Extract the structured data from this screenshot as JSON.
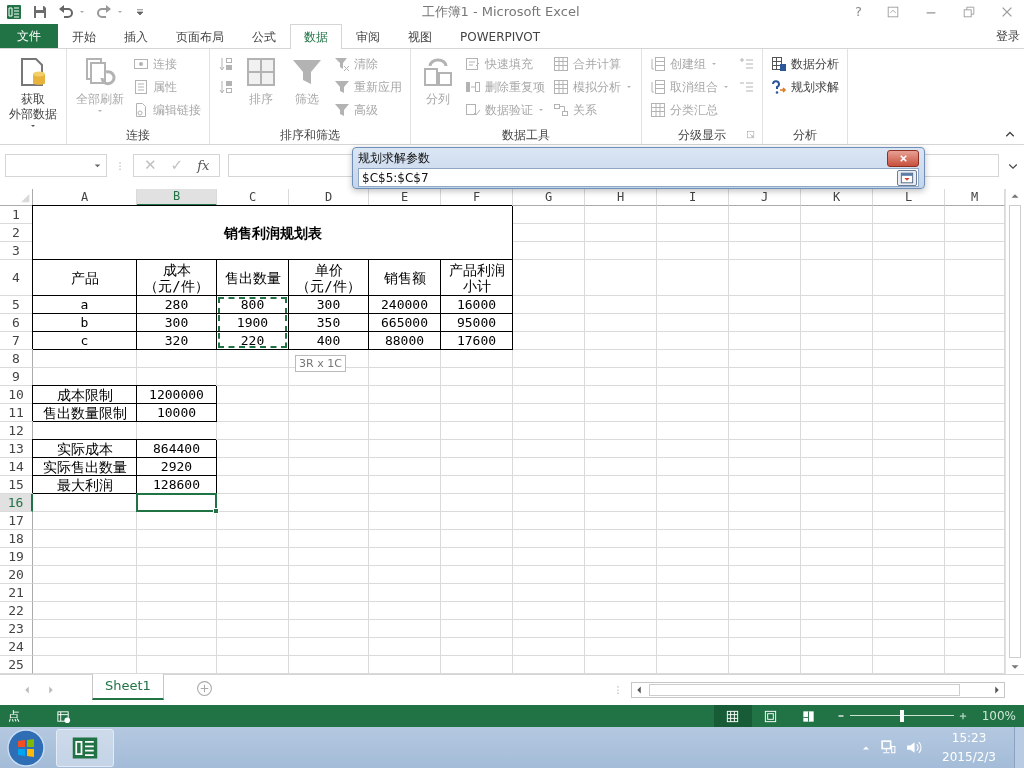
{
  "title_bar": {
    "title": "工作簿1 - Microsoft Excel",
    "help": "?"
  },
  "ribbon_tabs": [
    {
      "label": "文件",
      "kind": "file",
      "selected": false
    },
    {
      "label": "开始",
      "kind": "tab",
      "selected": false
    },
    {
      "label": "插入",
      "kind": "tab",
      "selected": false
    },
    {
      "label": "页面布局",
      "kind": "tab",
      "selected": false
    },
    {
      "label": "公式",
      "kind": "tab",
      "selected": false
    },
    {
      "label": "数据",
      "kind": "tab",
      "selected": true
    },
    {
      "label": "审阅",
      "kind": "tab",
      "selected": false
    },
    {
      "label": "视图",
      "kind": "tab",
      "selected": false
    },
    {
      "label": "POWERPIVOT",
      "kind": "tab",
      "selected": false
    }
  ],
  "account": "登录",
  "ribbon_groups": [
    {
      "columns": [
        [
          {
            "label": [
              "获取",
              "外部数据"
            ],
            "kind": "large",
            "disabled": false,
            "dropdown": true
          }
        ]
      ]
    },
    {
      "label": "连接",
      "columns": [
        [
          {
            "label": "全部刷新",
            "kind": "large",
            "disabled": true,
            "dropdown": true
          }
        ],
        [
          {
            "label": "连接",
            "kind": "small",
            "disabled": true
          },
          {
            "label": "属性",
            "kind": "small",
            "disabled": true
          },
          {
            "label": "编辑链接",
            "kind": "small",
            "disabled": true
          }
        ]
      ]
    },
    {
      "label": "排序和筛选",
      "columns": [
        [
          {
            "kind": "icon",
            "disabled": true
          },
          {
            "kind": "icon",
            "disabled": true
          }
        ],
        [
          {
            "label": "排序",
            "kind": "large",
            "disabled": true
          }
        ],
        [
          {
            "label": "筛选",
            "kind": "large",
            "disabled": true
          }
        ],
        [
          {
            "label": "清除",
            "kind": "small",
            "disabled": true
          },
          {
            "label": "重新应用",
            "kind": "small",
            "disabled": true
          },
          {
            "label": "高级",
            "kind": "small",
            "disabled": true
          }
        ]
      ]
    },
    {
      "label": "数据工具",
      "columns": [
        [
          {
            "label": "分列",
            "kind": "large",
            "disabled": true
          }
        ],
        [
          {
            "label": "快速填充",
            "kind": "small",
            "disabled": true
          },
          {
            "label": "删除重复项",
            "kind": "small",
            "disabled": true
          },
          {
            "label": "数据验证",
            "kind": "small",
            "disabled": true,
            "dropdown": true
          }
        ],
        [
          {
            "label": "合并计算",
            "kind": "small",
            "disabled": true
          },
          {
            "label": "模拟分析",
            "kind": "small",
            "disabled": true,
            "dropdown": true
          },
          {
            "label": "关系",
            "kind": "small",
            "disabled": true
          }
        ]
      ]
    },
    {
      "label": "分级显示",
      "launcher": true,
      "columns": [
        [
          {
            "label": "创建组",
            "kind": "small",
            "disabled": true,
            "dropdown": true
          },
          {
            "label": "取消组合",
            "kind": "small",
            "disabled": true,
            "dropdown": true
          },
          {
            "label": "分类汇总",
            "kind": "small",
            "disabled": true
          }
        ],
        [
          {
            "kind": "icon",
            "disabled": true
          },
          {
            "kind": "icon",
            "disabled": true
          }
        ]
      ]
    },
    {
      "label": "分析",
      "columns": [
        [
          {
            "label": "数据分析",
            "kind": "small",
            "disabled": false
          },
          {
            "label": "规划求解",
            "kind": "small",
            "disabled": false
          }
        ]
      ]
    }
  ],
  "formula_bar": {
    "buttons": [
      {
        "label": "✕",
        "disabled": true
      },
      {
        "label": "✓",
        "disabled": true
      },
      {
        "label": "fx",
        "disabled": false
      }
    ]
  },
  "solver_dialog": {
    "title": "规划求解参数",
    "value": "$C$5:$C$7"
  },
  "sheet": {
    "columns": [
      {
        "label": "A",
        "selected": false
      },
      {
        "label": "B",
        "selected": true
      },
      {
        "label": "C",
        "selected": false
      },
      {
        "label": "D",
        "selected": false
      },
      {
        "label": "E",
        "selected": false
      },
      {
        "label": "F",
        "selected": false
      },
      {
        "label": "G",
        "selected": false
      },
      {
        "label": "H",
        "selected": false
      },
      {
        "label": "I",
        "selected": false
      },
      {
        "label": "J",
        "selected": false
      },
      {
        "label": "K",
        "selected": false
      },
      {
        "label": "L",
        "selected": false
      },
      {
        "label": "M",
        "selected": false
      }
    ],
    "rows": [
      {
        "label": "1",
        "selected": false
      },
      {
        "label": "2",
        "selected": false
      },
      {
        "label": "3",
        "selected": false
      },
      {
        "label": "4",
        "selected": false
      },
      {
        "label": "5",
        "selected": false
      },
      {
        "label": "6",
        "selected": false
      },
      {
        "label": "7",
        "selected": false
      },
      {
        "label": "8",
        "selected": false
      },
      {
        "label": "9",
        "selected": false
      },
      {
        "label": "10",
        "selected": false
      },
      {
        "label": "11",
        "selected": false
      },
      {
        "label": "12",
        "selected": false
      },
      {
        "label": "13",
        "selected": false
      },
      {
        "label": "14",
        "selected": false
      },
      {
        "label": "15",
        "selected": false
      },
      {
        "label": "16",
        "selected": true
      },
      {
        "label": "17",
        "selected": false
      },
      {
        "label": "18",
        "selected": false
      },
      {
        "label": "19",
        "selected": false
      },
      {
        "label": "20",
        "selected": false
      },
      {
        "label": "21",
        "selected": false
      },
      {
        "label": "22",
        "selected": false
      },
      {
        "label": "23",
        "selected": false
      },
      {
        "label": "24",
        "selected": false
      },
      {
        "label": "25",
        "selected": false
      }
    ],
    "title": "销售利润规划表",
    "table": {
      "headers": [
        "产品",
        [
          "成本",
          "（元/件）"
        ],
        "售出数量",
        [
          "单价",
          "（元/件）"
        ],
        "销售额",
        [
          "产品利润",
          "小计"
        ]
      ],
      "rows": [
        [
          "a",
          "280",
          "800",
          "300",
          "240000",
          "16000"
        ],
        [
          "b",
          "300",
          "1900",
          "350",
          "665000",
          "95000"
        ],
        [
          "c",
          "320",
          "220",
          "400",
          "88000",
          "17600"
        ]
      ]
    },
    "limits": [
      {
        "label": "成本限制",
        "value": "1200000"
      },
      {
        "label": "售出数量限制",
        "value": "10000"
      }
    ],
    "results": [
      {
        "label": "实际成本",
        "value": "864400"
      },
      {
        "label": "实际售出数量",
        "value": "2920"
      },
      {
        "label": "最大利润",
        "value": "128600"
      }
    ],
    "selection_tip": "3R x 1C"
  },
  "sheet_tabs": [
    {
      "label": "Sheet1",
      "selected": true
    }
  ],
  "status_bar": {
    "mode": "点",
    "views": [
      {
        "kind": "normal",
        "selected": true
      },
      {
        "kind": "page_layout",
        "selected": false
      },
      {
        "kind": "page_break",
        "selected": false
      }
    ],
    "zoom": {
      "level": 0.5,
      "reading": "100%"
    }
  },
  "taskbar": {
    "time": "15:23",
    "date": "2015/2/3"
  }
}
